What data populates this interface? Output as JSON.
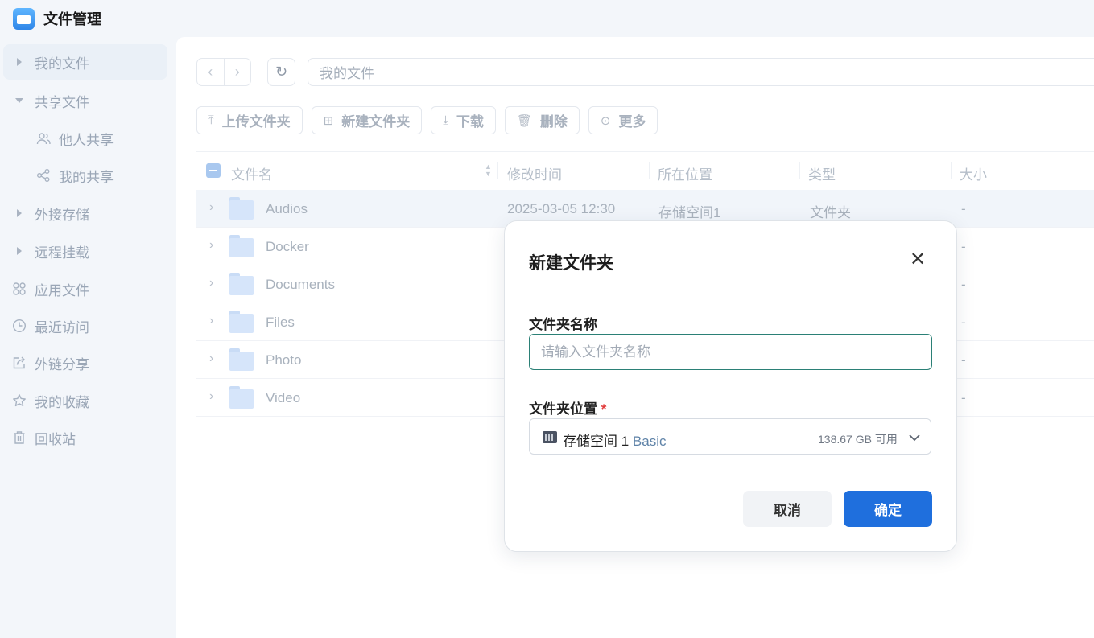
{
  "app": {
    "title": "文件管理",
    "icon": "folder-app-icon"
  },
  "sidebar": {
    "items": [
      {
        "label": "我的文件",
        "icon": "caret-right-icon"
      },
      {
        "label": "共享文件",
        "icon": "caret-down-icon"
      },
      {
        "label": "他人共享",
        "icon": "users-icon"
      },
      {
        "label": "我的共享",
        "icon": "share-icon"
      },
      {
        "label": "外接存储",
        "icon": "caret-right-icon"
      },
      {
        "label": "远程挂载",
        "icon": "caret-right-icon"
      },
      {
        "label": "应用文件",
        "icon": "grid-icon"
      },
      {
        "label": "最近访问",
        "icon": "clock-icon"
      },
      {
        "label": "外链分享",
        "icon": "external-link-icon"
      },
      {
        "label": "我的收藏",
        "icon": "star-icon"
      },
      {
        "label": "回收站",
        "icon": "trash-icon"
      }
    ]
  },
  "path": {
    "current": "我的文件"
  },
  "toolbar": {
    "upload_folder": "上传文件夹",
    "new_folder": "新建文件夹",
    "download": "下载",
    "delete": "删除",
    "more": "更多"
  },
  "table": {
    "columns": [
      "文件名",
      "修改时间",
      "所在位置",
      "类型",
      "大小"
    ],
    "rows": [
      {
        "name": "Audios",
        "modified": "2025-03-05 12:30",
        "location": "存储空间1",
        "type": "文件夹",
        "size": "-"
      },
      {
        "name": "Docker",
        "size": "-"
      },
      {
        "name": "Documents",
        "size": "-"
      },
      {
        "name": "Files",
        "size": "-"
      },
      {
        "name": "Photo",
        "size": "-"
      },
      {
        "name": "Video",
        "size": "-"
      }
    ]
  },
  "dialog": {
    "title": "新建文件夹",
    "name_label": "文件夹名称",
    "name_placeholder": "请输入文件夹名称",
    "name_value": "",
    "location_label": "文件夹位置",
    "required_mark": "*",
    "location_name": "存储空间 1",
    "location_tag": "Basic",
    "location_available": "138.67 GB 可用",
    "cancel": "取消",
    "confirm": "确定"
  },
  "colors": {
    "primary": "#1f6fdd",
    "input_focus": "#2b8076",
    "required": "#e23b3b"
  }
}
